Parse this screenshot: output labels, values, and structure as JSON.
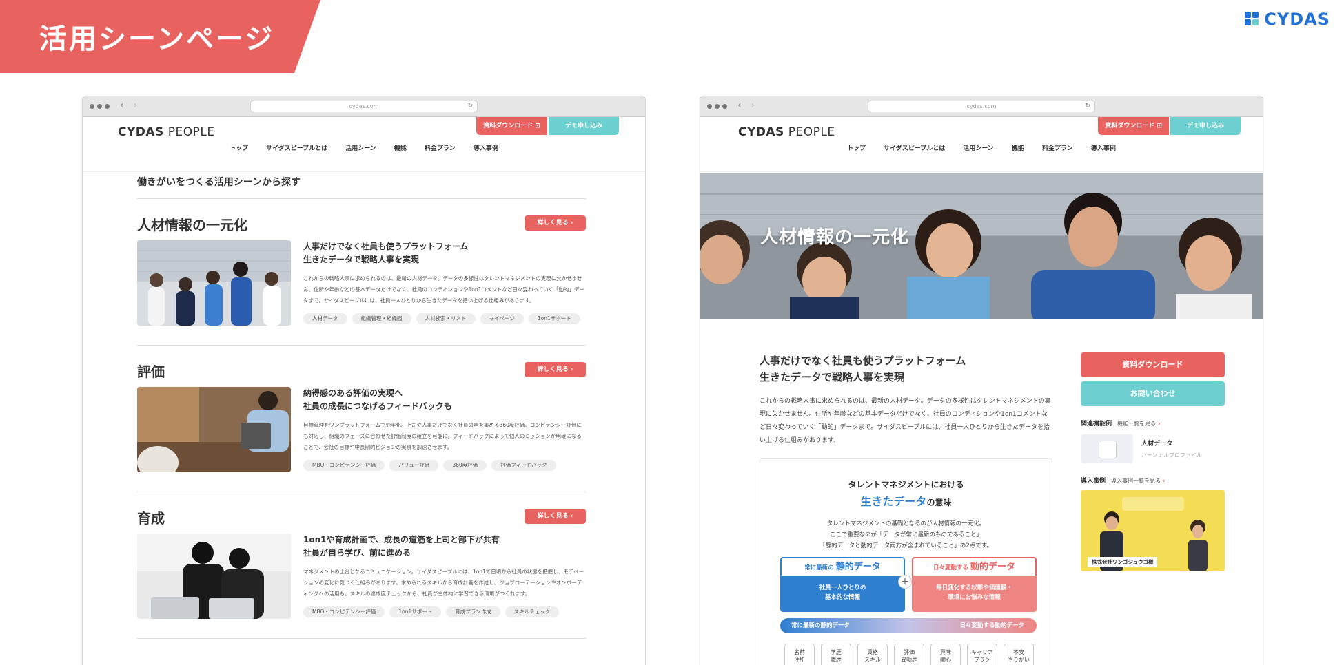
{
  "banner": {
    "title": "活用シーンページ"
  },
  "brand": {
    "name": "CYDAS"
  },
  "browser": {
    "url": "cydas.com"
  },
  "site": {
    "logo_bold": "CYDAS",
    "logo_rest": " PEOPLE",
    "download_btn": "資料ダウンロード ⊡",
    "demo_btn": "デモ申し込み",
    "nav": [
      "トップ",
      "サイダスピープルとは",
      "活用シーン",
      "機能",
      "料金プラン",
      "導入事例"
    ]
  },
  "left": {
    "section_title": "働きがいをつくる活用シーンから探す",
    "more_label": "詳しく見る ›",
    "scenes": [
      {
        "title": "人材情報の一元化",
        "lead1": "人事だけでなく社員も使うプラットフォーム",
        "lead2": "生きたデータで戦略人事を実現",
        "body": "これからの戦略人事に求められるのは、最新の人材データ。データの多様性はタレントマネジメントの実現に欠かせません。住所や年齢などの基本データだけでなく、社員のコンディションや1on1コメントなど日々変わっていく「動的」データまで。サイダスピープルには、社員一人ひとりから生きたデータを拾い上げる仕組みがあります。",
        "tags": [
          "人材データ",
          "組織管理・組織図",
          "人材検索・リスト",
          "マイページ",
          "1on1サポート"
        ]
      },
      {
        "title": "評価",
        "lead1": "納得感のある評価の実現へ",
        "lead2": "社員の成長につなげるフィードバックも",
        "body": "目標管理をワンプラットフォームで効率化。上司や人事だけでなく社員の声を集める360度評価、コンピテンシー評価にも対応し、組織のフェーズに合わせた評価制度の確立を可能に。フィードバックによって個人のミッションが明確になることで、会社の目標や中長期的ビジョンの実現を加速させます。",
        "tags": [
          "MBO・コンピテンシー評価",
          "バリュー評価",
          "360度評価",
          "評価フィードバック"
        ]
      },
      {
        "title": "育成",
        "lead1": "1on1や育成計画で、成長の道筋を上司と部下が共有",
        "lead2": "社員が自ら学び、前に進める",
        "body": "マネジメントの土台となるコミュニケーション。サイダスピープルには、1on1で日頃から社員の状態を把握し、モチベーションの変化に気づく仕組みがあります。求められるスキルから育成計画を作成し、ジョブローテーションやオンボーディングへの活用も。スキルの達成度チェックから、社員が主体的に学習できる環境がつくれます。",
        "tags": [
          "MBO・コンピテンシー評価",
          "1on1サポート",
          "育成プラン作成",
          "スキルチェック"
        ]
      }
    ]
  },
  "right": {
    "hero_title": "人材情報の一元化",
    "lead1": "人事だけでなく社員も使うプラットフォーム",
    "lead2": "生きたデータで戦略人事を実現",
    "body": "これからの戦略人事に求められるのは、最新の人材データ。データの多様性はタレントマネジメントの実現に欠かせません。住所や年齢などの基本データだけでなく、社員のコンディションや1on1コメントなど日々変わっていく「動的」データまで。サイダスピープルには、社員一人ひとりから生きたデータを拾い上げる仕組みがあります。",
    "card": {
      "t1": "タレントマネジメントにおける",
      "t2_em": "生きたデータ",
      "t2_rest": "の意味",
      "desc1": "タレントマネジメントの基礎となるのが人材情報の一元化。",
      "desc2": "ここで重要なのが「データが常に最新のものであること」",
      "desc3": "「静的データと動的データ両方が含まれていること」の2点です。",
      "static_prefix": "常に最新の",
      "static_em": "静的データ",
      "static_body1": "社員一人ひとりの",
      "static_body2": "基本的な情報",
      "dynamic_prefix": "日々変動する",
      "dynamic_em": "動的データ",
      "dynamic_body1": "毎日変化する状態や価値観・",
      "dynamic_body2": "環境にお悩みな情報",
      "bar_left": "常に最新の静的データ",
      "bar_right": "日々変動する動的データ",
      "chips": [
        "名前\n住所",
        "学歴\n職歴",
        "資格\nスキル",
        "評価\n異動歴",
        "興味\n関心",
        "キャリア\nプラン",
        "不安\nやりがい"
      ]
    },
    "side": {
      "download": "資料ダウンロード",
      "contact": "お問い合わせ",
      "related_label": "関連機能例",
      "related_link": "機能一覧を見る",
      "feature_name": "人材データ",
      "feature_sub": "パーソナルプロファイル",
      "case_label": "導入事例",
      "case_link": "導入事例一覧を見る",
      "case_company": "株式会社ワンゴジュウゴ様"
    }
  }
}
